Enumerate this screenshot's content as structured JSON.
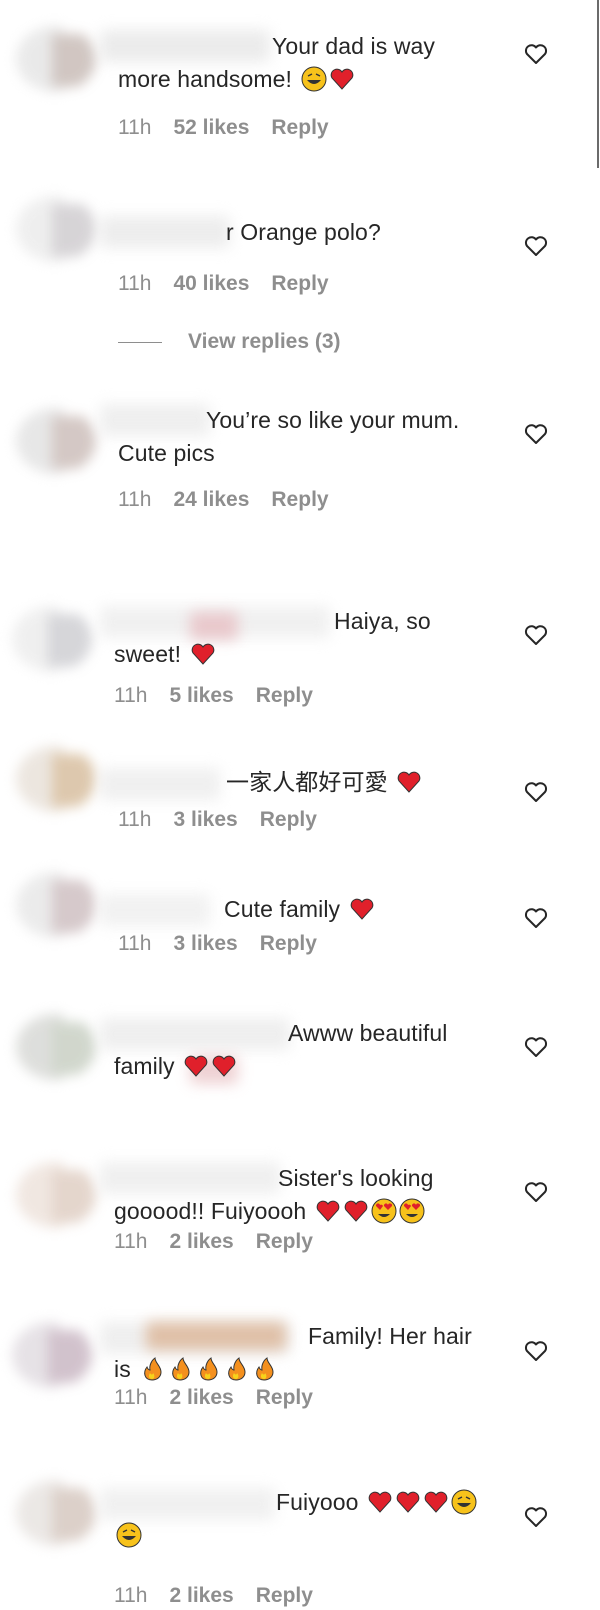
{
  "comments": [
    {
      "text": "Your dad is way more handsome!",
      "emoji": [
        "laugh",
        "heart"
      ],
      "time": "11h",
      "likes": "52 likes",
      "reply": "Reply"
    },
    {
      "text": "r Orange polo?",
      "emoji": [],
      "time": "11h",
      "likes": "40 likes",
      "reply": "Reply"
    },
    {
      "text": "You’re so like your mum. Cute pics",
      "emoji": [],
      "time": "11h",
      "likes": "24 likes",
      "reply": "Reply"
    },
    {
      "text": "Haiya, so sweet!",
      "emoji": [
        "heart"
      ],
      "time": "11h",
      "likes": "5 likes",
      "reply": "Reply"
    },
    {
      "text": "一家人都好可愛",
      "emoji": [
        "heart"
      ],
      "time": "11h",
      "likes": "3 likes",
      "reply": "Reply"
    },
    {
      "text": "Cute family",
      "emoji": [
        "heart"
      ],
      "time": "11h",
      "likes": "3 likes",
      "reply": "Reply"
    },
    {
      "text": "Awww beautiful family",
      "emoji": [
        "heart",
        "heart"
      ],
      "time": "",
      "likes": "",
      "reply": ""
    },
    {
      "text": "Sister's looking gooood!! Fuiyoooh",
      "emoji": [
        "heart",
        "heart",
        "love",
        "love"
      ],
      "time": "11h",
      "likes": "2 likes",
      "reply": "Reply"
    },
    {
      "text": "Family! Her hair is",
      "emoji": [
        "fire",
        "fire",
        "fire",
        "fire",
        "fire"
      ],
      "time": "11h",
      "likes": "2 likes",
      "reply": "Reply"
    },
    {
      "text": "Fuiyooo",
      "emoji": [
        "heart",
        "heart",
        "heart",
        "laugh",
        "laugh"
      ],
      "time": "11h",
      "likes": "2 likes",
      "reply": "Reply"
    }
  ],
  "view_replies": "View replies (3)",
  "colors": {
    "text": "#262626",
    "muted": "#8e8e8e",
    "heart": "#e0202b",
    "emoji_face": "#f7c21b"
  }
}
